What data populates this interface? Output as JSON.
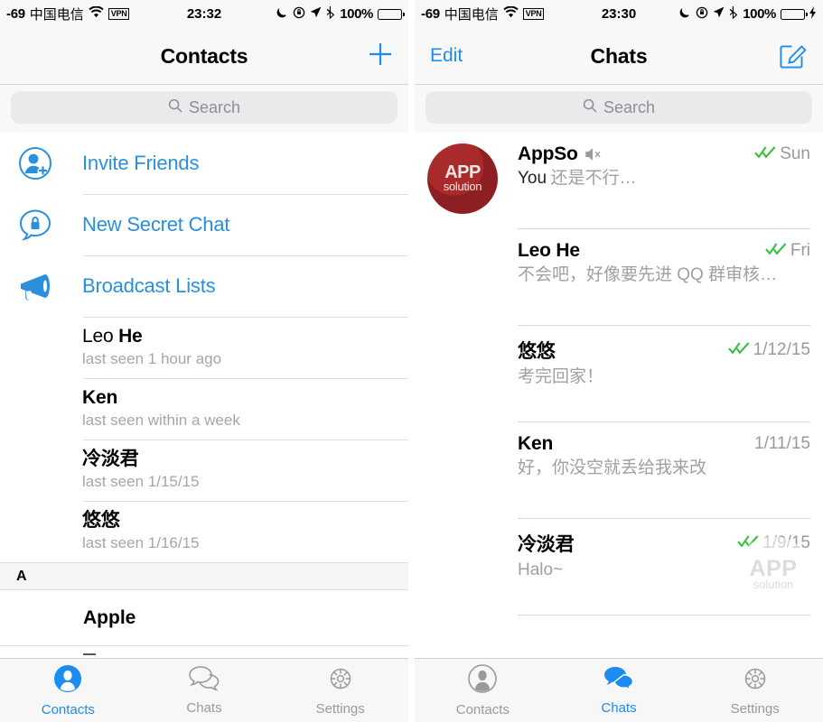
{
  "accent_color": "#1c8cf0",
  "check_color": "#35c13f",
  "screens": [
    {
      "id": "contacts",
      "status_bar": {
        "signal": "-69",
        "carrier": "中国电信",
        "wifi_icon": "wifi-icon",
        "vpn_label": "VPN",
        "time": "23:32",
        "moon_icon": "moon-icon",
        "lock_rotation_icon": "rotation-lock-icon",
        "location_icon": "location-arrow-icon",
        "bluetooth_icon": "bluetooth-icon",
        "battery_percent": "100%",
        "battery_state": "full-dark"
      },
      "nav": {
        "left_label": "",
        "title": "Contacts",
        "right_icon": "plus-icon"
      },
      "search": {
        "placeholder": "Search",
        "icon": "search-icon",
        "value": ""
      },
      "actions": [
        {
          "label": "Invite Friends",
          "icon": "add-person-icon"
        },
        {
          "label": "New Secret Chat",
          "icon": "lock-bubble-icon"
        },
        {
          "label": "Broadcast Lists",
          "icon": "megaphone-icon"
        }
      ],
      "contacts": [
        {
          "first": "Leo ",
          "last": "He",
          "subtitle": "last seen 1 hour ago",
          "avatar": "beach",
          "cjk": false
        },
        {
          "first": "",
          "last": "Ken",
          "subtitle": "last seen within a week",
          "avatar": "ken",
          "cjk": false
        },
        {
          "first": "",
          "last": "冷淡君",
          "subtitle": "last seen 1/15/15",
          "avatar": "leng",
          "cjk": true
        },
        {
          "first": "",
          "last": "悠悠",
          "subtitle": "last seen 1/16/15",
          "avatar": "cat",
          "cjk": true
        }
      ],
      "section_header": "A",
      "section_rows": [
        {
          "name": "Apple"
        }
      ],
      "tabs": [
        {
          "label": "Contacts",
          "icon": "person-icon",
          "active": true
        },
        {
          "label": "Chats",
          "icon": "chat-bubbles-icon",
          "active": false
        },
        {
          "label": "Settings",
          "icon": "gear-icon",
          "active": false
        }
      ]
    },
    {
      "id": "chats",
      "status_bar": {
        "signal": "-69",
        "carrier": "中国电信",
        "wifi_icon": "wifi-icon",
        "vpn_label": "VPN",
        "time": "23:30",
        "moon_icon": "moon-icon",
        "lock_rotation_icon": "rotation-lock-icon",
        "location_icon": "location-arrow-icon",
        "bluetooth_icon": "bluetooth-icon",
        "battery_percent": "100%",
        "battery_state": "charging-green"
      },
      "nav": {
        "left_label": "Edit",
        "title": "Chats",
        "right_icon": "compose-icon"
      },
      "search": {
        "placeholder": "Search",
        "icon": "search-icon",
        "value": ""
      },
      "chats": [
        {
          "name": "AppSo",
          "muted": true,
          "mute_icon": "mute-icon",
          "from": "You",
          "message": "还是不行…",
          "date": "Sun",
          "read_receipt": "double-check",
          "avatar": "appso"
        },
        {
          "name": "Leo He",
          "muted": false,
          "from": "",
          "message": "不会吧，好像要先进 QQ 群审核…",
          "date": "Fri",
          "read_receipt": "double-check",
          "avatar": "beach"
        },
        {
          "name": "悠悠",
          "muted": false,
          "from": "",
          "message": "考完回家！",
          "date": "1/12/15",
          "read_receipt": "double-check",
          "avatar": "cat"
        },
        {
          "name": "Ken",
          "muted": false,
          "from": "",
          "message": "好，你没空就丢给我来改",
          "date": "1/11/15",
          "read_receipt": "none",
          "avatar": "ken"
        },
        {
          "name": "冷淡君",
          "muted": false,
          "from": "",
          "message": "Halo~",
          "date": "1/9/15",
          "read_receipt": "double-check",
          "avatar": "leng"
        }
      ],
      "watermark": {
        "line1": "APP",
        "line2": "solution"
      },
      "tabs": [
        {
          "label": "Contacts",
          "icon": "person-icon",
          "active": false
        },
        {
          "label": "Chats",
          "icon": "chat-bubbles-icon",
          "active": true
        },
        {
          "label": "Settings",
          "icon": "gear-icon",
          "active": false
        }
      ]
    }
  ],
  "appso_avatar_text": {
    "line1": "APP",
    "line2": "solution"
  }
}
